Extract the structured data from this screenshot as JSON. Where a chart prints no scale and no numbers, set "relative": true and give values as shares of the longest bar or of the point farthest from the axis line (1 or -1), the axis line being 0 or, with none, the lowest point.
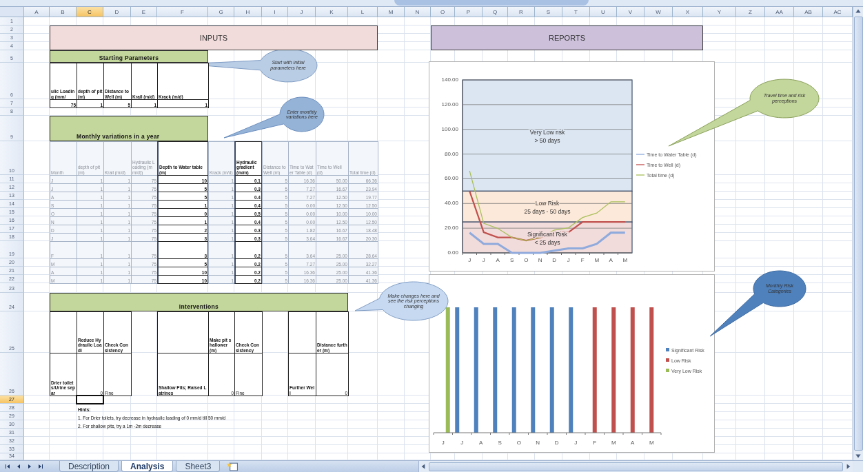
{
  "column_headers": [
    {
      "label": "A",
      "selected": false
    },
    {
      "label": "B",
      "selected": false
    },
    {
      "label": "C",
      "selected": true
    },
    {
      "label": "D",
      "selected": false
    },
    {
      "label": "E",
      "selected": false
    },
    {
      "label": "F",
      "selected": false
    },
    {
      "label": "G",
      "selected": false
    },
    {
      "label": "H",
      "selected": false
    },
    {
      "label": "I",
      "selected": false
    },
    {
      "label": "J",
      "selected": false
    },
    {
      "label": "K",
      "selected": false
    },
    {
      "label": "L",
      "selected": false
    },
    {
      "label": "M",
      "selected": false
    },
    {
      "label": "N",
      "selected": false
    },
    {
      "label": "O",
      "selected": false
    },
    {
      "label": "P",
      "selected": false
    },
    {
      "label": "Q",
      "selected": false
    },
    {
      "label": "R",
      "selected": false
    },
    {
      "label": "S",
      "selected": false
    },
    {
      "label": "T",
      "selected": false
    },
    {
      "label": "U",
      "selected": false
    },
    {
      "label": "V",
      "selected": false
    },
    {
      "label": "W",
      "selected": false
    },
    {
      "label": "X",
      "selected": false
    },
    {
      "label": "Y",
      "selected": false
    },
    {
      "label": "Z",
      "selected": false
    },
    {
      "label": "AA",
      "selected": false
    },
    {
      "label": "AB",
      "selected": false
    },
    {
      "label": "AC",
      "selected": false
    }
  ],
  "row_headers": [
    {
      "label": "1",
      "selected": false
    },
    {
      "label": "2",
      "selected": false
    },
    {
      "label": "3",
      "selected": false
    },
    {
      "label": "4",
      "selected": false
    },
    {
      "label": "5",
      "selected": false
    },
    {
      "label": "6",
      "selected": false
    },
    {
      "label": "7",
      "selected": false
    },
    {
      "label": "8",
      "selected": false
    },
    {
      "label": "9",
      "selected": false
    },
    {
      "label": "10",
      "selected": false
    },
    {
      "label": "11",
      "selected": false
    },
    {
      "label": "12",
      "selected": false
    },
    {
      "label": "13",
      "selected": false
    },
    {
      "label": "14",
      "selected": false
    },
    {
      "label": "15",
      "selected": false
    },
    {
      "label": "16",
      "selected": false
    },
    {
      "label": "17",
      "selected": false
    },
    {
      "label": "18",
      "selected": false
    },
    {
      "label": "19",
      "selected": false
    },
    {
      "label": "20",
      "selected": false
    },
    {
      "label": "21",
      "selected": false
    },
    {
      "label": "22",
      "selected": false
    },
    {
      "label": "23",
      "selected": false
    },
    {
      "label": "24",
      "selected": false
    },
    {
      "label": "25",
      "selected": false
    },
    {
      "label": "26",
      "selected": false
    },
    {
      "label": "27",
      "selected": true
    },
    {
      "label": "28",
      "selected": false
    },
    {
      "label": "29",
      "selected": false
    },
    {
      "label": "30",
      "selected": false
    },
    {
      "label": "31",
      "selected": false
    },
    {
      "label": "32",
      "selected": false
    },
    {
      "label": "33",
      "selected": false
    },
    {
      "label": "34",
      "selected": false
    }
  ],
  "inputs_banner": "INPUTS",
  "reports_banner": "REPORTS",
  "starting_parameters": {
    "title": "Starting Parameters",
    "headers": [
      "ulic Loading (mm/",
      "depth of pit (m)",
      "Distance to Well (m)",
      "Krail (m/d)",
      "Krack (m/d)"
    ],
    "values": [
      "75",
      "1",
      "5",
      "1",
      "1"
    ]
  },
  "monthly": {
    "title": "Monthly variations in a year",
    "columns": [
      {
        "label": "Month",
        "input": false
      },
      {
        "label": "depth of pit (m)",
        "input": false
      },
      {
        "label": "Krail (m/d)",
        "input": false
      },
      {
        "label": "Hydraulic Loading (mm/d))",
        "input": false
      },
      {
        "label": "Depth to Water table (m)",
        "input": true
      },
      {
        "label": "Krack (m/d)",
        "input": false
      },
      {
        "label": "Hydraulic gradient (m/m)",
        "input": true
      },
      {
        "label": "Distance to Well (m)",
        "input": false
      },
      {
        "label": "Time to Water Table (d)",
        "input": false
      },
      {
        "label": "Time to Well (d)",
        "input": false
      },
      {
        "label": "Total time (d)",
        "input": false
      }
    ],
    "rows": [
      [
        "J",
        "1",
        "1",
        "75",
        "10",
        "1",
        "0.1",
        "5",
        "16.36",
        "50.00",
        "66.36"
      ],
      [
        "J",
        "1",
        "1",
        "75",
        "5",
        "1",
        "0.3",
        "5",
        "7.27",
        "16.67",
        "23.94"
      ],
      [
        "A",
        "1",
        "1",
        "75",
        "5",
        "1",
        "0.4",
        "5",
        "7.27",
        "12.50",
        "19.77"
      ],
      [
        "S",
        "1",
        "1",
        "75",
        "1",
        "1",
        "0.4",
        "5",
        "0.00",
        "12.50",
        "12.50"
      ],
      [
        "O",
        "1",
        "1",
        "75",
        "0",
        "1",
        "0.5",
        "5",
        "0.00",
        "10.00",
        "10.00"
      ],
      [
        "N",
        "1",
        "1",
        "75",
        "1",
        "1",
        "0.4",
        "5",
        "0.00",
        "12.50",
        "12.50"
      ],
      [
        "D",
        "1",
        "1",
        "75",
        "2",
        "1",
        "0.3",
        "5",
        "1.82",
        "16.67",
        "18.48"
      ],
      [
        "J",
        "1",
        "1",
        "75",
        "3",
        "1",
        "0.3",
        "5",
        "3.64",
        "16.67",
        "20.30"
      ],
      [
        "F",
        "1",
        "1",
        "75",
        "3",
        "1",
        "0.2",
        "5",
        "3.64",
        "25.00",
        "28.64"
      ],
      [
        "M",
        "1",
        "1",
        "75",
        "5",
        "1",
        "0.2",
        "5",
        "7.27",
        "25.00",
        "32.27"
      ],
      [
        "A",
        "1",
        "1",
        "75",
        "10",
        "1",
        "0.2",
        "5",
        "16.36",
        "25.00",
        "41.36"
      ],
      [
        "M",
        "1",
        "1",
        "75",
        "10",
        "1",
        "0.2",
        "5",
        "16.36",
        "25.00",
        "41.36"
      ]
    ]
  },
  "interventions": {
    "title": "Interventions",
    "groups": [
      {
        "option": "Drier toilets/Urine separ",
        "change_label": "Reduce Hydraulic Loadi",
        "change_value": "0",
        "check_label": "Check Consistency",
        "check_value": "Fine"
      },
      {
        "option": "Shallow Pits; Raised Latrines",
        "change_label": "Make pit shallower(m)",
        "change_value": "0",
        "check_label": "Check Consistency",
        "check_value": "Fine"
      },
      {
        "option": "Further Well",
        "change_label": "Distance further (m)",
        "change_value": "0"
      }
    ]
  },
  "hints": {
    "title": "Hints:",
    "lines": [
      "1. For Drier toilets, try decrease in hydraulic loading of 0 mm/d till 50 mm/d",
      "2. For shallow pits, try a 1m -2m decrease"
    ]
  },
  "callouts": [
    "Start with initial parameters here",
    "Enter monthly variations here",
    "Make changes here and see the risk perceptions changing",
    "Travel time and risk perceptions",
    "Monthly Risk Categories"
  ],
  "travel_chart": {
    "chart_data": {
      "type": "line",
      "categories": [
        "J",
        "J",
        "A",
        "S",
        "O",
        "N",
        "D",
        "J",
        "F",
        "M",
        "A",
        "M"
      ],
      "ylim": [
        0,
        140
      ],
      "yticks": [
        {
          "value": 0,
          "label": "0.00"
        },
        {
          "value": 20,
          "label": "20.00"
        },
        {
          "value": 40,
          "label": "40.00"
        },
        {
          "value": 60,
          "label": "60.00"
        },
        {
          "value": 80,
          "label": "80.00"
        },
        {
          "value": 100,
          "label": "100.00"
        },
        {
          "value": 120,
          "label": "120.00"
        },
        {
          "value": 140,
          "label": "140.00"
        }
      ],
      "series": [
        {
          "name": "Time to Water Table (d)",
          "color": "#8faadc",
          "values": [
            16.36,
            7.27,
            7.27,
            0,
            0,
            0,
            1.82,
            3.64,
            3.64,
            7.27,
            16.36,
            16.36
          ]
        },
        {
          "name": "Time to Well (d)",
          "color": "#c0504d",
          "values": [
            50,
            16.67,
            12.5,
            12.5,
            10,
            12.5,
            16.67,
            16.67,
            25,
            25,
            25,
            25
          ]
        },
        {
          "name": "Total time (d)",
          "color": "#a9c05a",
          "values": [
            66.36,
            23.94,
            19.77,
            12.5,
            10,
            12.5,
            18.48,
            20.3,
            28.64,
            32.27,
            41.36,
            41.36
          ]
        }
      ],
      "grid": true,
      "legend": "right",
      "bands": [
        {
          "axis": "y",
          "from": 50,
          "to": 140,
          "color": "#dce6f2",
          "label": "Very Low risk"
        },
        {
          "axis": "y",
          "from": 25,
          "to": 50,
          "color": "#fde9d9",
          "label": "Low Risk"
        },
        {
          "axis": "y",
          "from": 0,
          "to": 25,
          "color": "#f2dcdb",
          "label": "Significant Risk"
        }
      ],
      "annotations": [
        "> 50 days",
        "25 days - 50 days",
        "< 25 days"
      ]
    }
  },
  "risk_chart": {
    "chart_data": {
      "type": "bar",
      "relative": true,
      "legend": "right",
      "categories": [
        "J",
        "J",
        "A",
        "S",
        "O",
        "N",
        "D",
        "J",
        "F",
        "M",
        "A",
        "M"
      ],
      "series": [
        {
          "name": "Significant Risk",
          "color": "#4f81bd",
          "values": [
            null,
            1,
            1,
            1,
            1,
            1,
            1,
            1,
            null,
            null,
            null,
            null
          ]
        },
        {
          "name": "Low Risk",
          "color": "#c0504d",
          "values": [
            null,
            null,
            null,
            null,
            null,
            null,
            null,
            null,
            1,
            1,
            1,
            1
          ]
        },
        {
          "name": "Very Low Risk",
          "color": "#9bbb59",
          "values": [
            1,
            null,
            null,
            null,
            null,
            null,
            null,
            null,
            null,
            null,
            null,
            null
          ]
        }
      ]
    }
  },
  "sheet_tabs": [
    {
      "label": "Description",
      "selected": false
    },
    {
      "label": "Analysis",
      "selected": true
    },
    {
      "label": "Sheet3",
      "selected": false
    }
  ]
}
